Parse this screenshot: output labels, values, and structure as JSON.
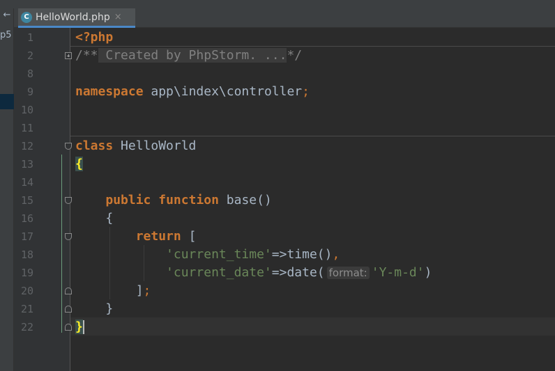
{
  "sidebar": {
    "back_label": "←",
    "partial_label": "p5"
  },
  "tab": {
    "icon_letter": "C",
    "title": "HelloWorld.php",
    "close": "×"
  },
  "line_numbers": [
    "1",
    "2",
    "8",
    "9",
    "10",
    "11",
    "12",
    "13",
    "14",
    "15",
    "16",
    "17",
    "18",
    "19",
    "20",
    "21",
    "22"
  ],
  "code": {
    "open_tag": "<?php",
    "comment_open": "/**",
    "comment_fold": " Created by PhpStorm. ...",
    "comment_close": "*/",
    "ns_kw": "namespace",
    "ns_path": " app\\index\\controller",
    "ns_semi": ";",
    "class_kw": "class",
    "class_name": " HelloWorld",
    "open_brace": "{",
    "public_kw": "public",
    "function_kw": " function",
    "method_sig": " base()",
    "method_open": "{",
    "return_kw": "return",
    "return_rest": " [",
    "key1": "'current_time'",
    "arrow1": "=>time()",
    "comma1": ",",
    "key2": "'current_date'",
    "arrow2": "=>date(",
    "hint_label": "format:",
    "val2": "'Y-m-d'",
    "close_paren": ")",
    "array_close": "]",
    "array_semi": ";",
    "method_close": "}",
    "class_close": "}"
  }
}
